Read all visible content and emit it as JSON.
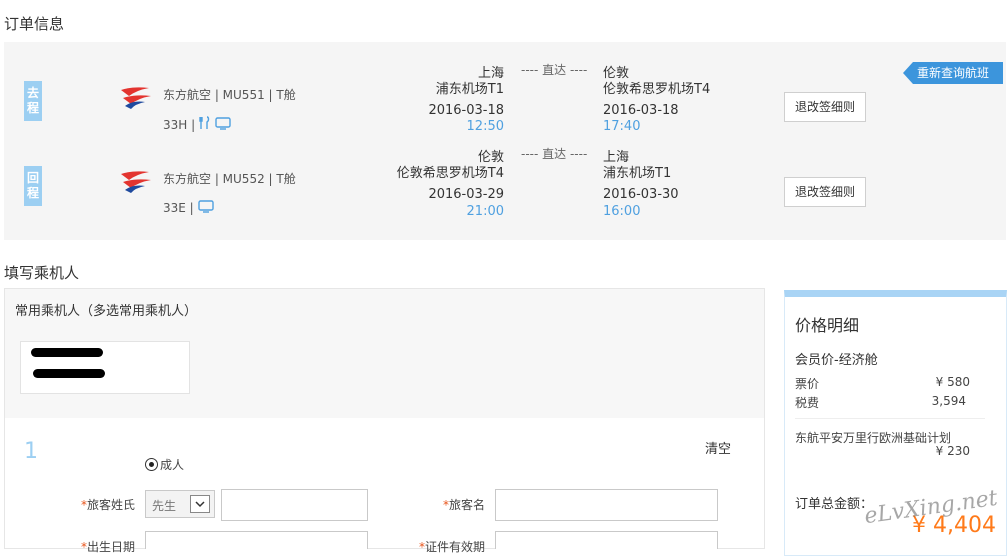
{
  "sections": {
    "order_info": "订单信息",
    "fill_passenger": "填写乘机人"
  },
  "requery_button": "重新查询航班",
  "flights": [
    {
      "tag": "去\n程",
      "airline": "东方航空 | MU551 | T舱",
      "seat": "33H |",
      "icons": [
        "meal-icon",
        "seat-screen-icon"
      ],
      "dep_city": "上海",
      "dep_airport": "浦东机场T1",
      "dep_date": "2016-03-18",
      "dep_time": "12:50",
      "direct": "---- 直达 ----",
      "arr_city": "伦敦",
      "arr_airport": "伦敦希思罗机场T4",
      "arr_date": "2016-03-18",
      "arr_time": "17:40",
      "rules_button": "退改签细则"
    },
    {
      "tag": "回\n程",
      "airline": "东方航空 | MU552 | T舱",
      "seat": "33E |",
      "icons": [
        "seat-screen-icon"
      ],
      "dep_city": "伦敦",
      "dep_airport": "伦敦希思罗机场T4",
      "dep_date": "2016-03-29",
      "dep_time": "21:00",
      "direct": "---- 直达 ----",
      "arr_city": "上海",
      "arr_airport": "浦东机场T1",
      "arr_date": "2016-03-30",
      "arr_time": "16:00",
      "rules_button": "退改签细则"
    }
  ],
  "passenger": {
    "frequent_title": "常用乘机人（多选常用乘机人）",
    "index": "1",
    "clear": "清空",
    "type_option": "成人",
    "surname_label": "旅客姓氏",
    "title_select": "先生",
    "given_name_label": "旅客名",
    "birth_label": "出生日期",
    "id_valid_label": "证件有效期",
    "required_mark": "*"
  },
  "price": {
    "title": "价格明细",
    "cabin": "会员价-经济舱",
    "ticket_label": "票价",
    "ticket_value": "¥ 580",
    "tax_label": "税费",
    "tax_value": "3,594",
    "insurance_label": "东航平安万里行欧洲基础计划",
    "insurance_value": "¥ 230",
    "total_label": "订单总金额：",
    "total_value": "¥ 4,404"
  },
  "watermark": "eLvXing.net",
  "colors": {
    "accent": "#3c95dc",
    "tag": "#9ccff2",
    "time": "#4fa0e0",
    "price": "#ff7a1a"
  }
}
